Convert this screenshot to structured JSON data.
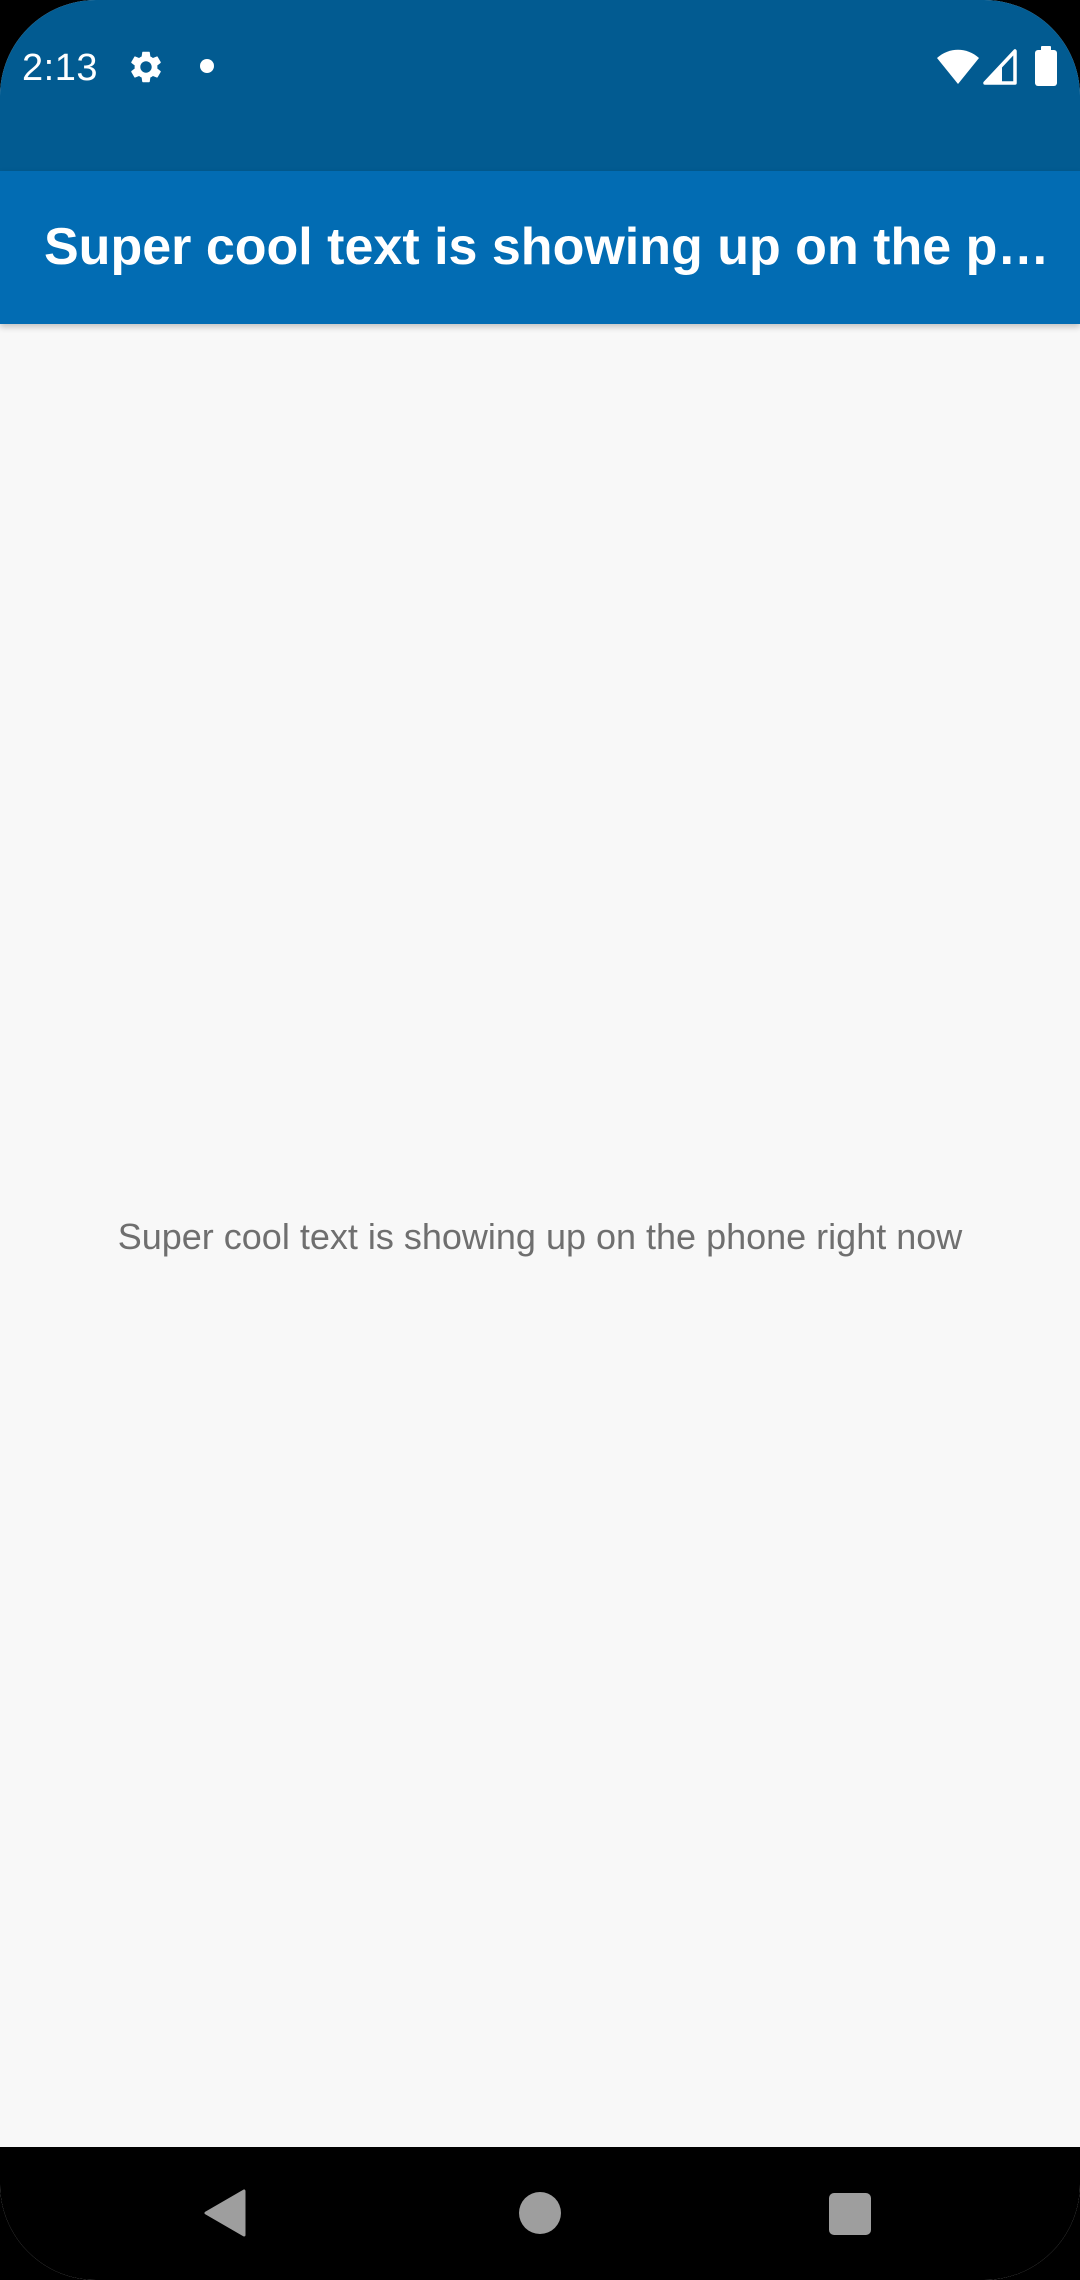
{
  "status_bar": {
    "time": "2:13",
    "icons": [
      "gear-icon",
      "notification-dot-icon",
      "wifi-icon",
      "cell-signal-icon",
      "battery-icon"
    ],
    "background_color": "#025b91"
  },
  "app_bar": {
    "title": "Super cool text is showing up on the phone right now",
    "background_color": "#026cb3"
  },
  "main": {
    "text": "Super cool text is showing up on the phone right now",
    "text_color": "#6f6f6f",
    "background_color": "#f8f8f8"
  },
  "nav_bar": {
    "buttons": [
      "back-icon",
      "home-icon",
      "recents-icon"
    ]
  }
}
